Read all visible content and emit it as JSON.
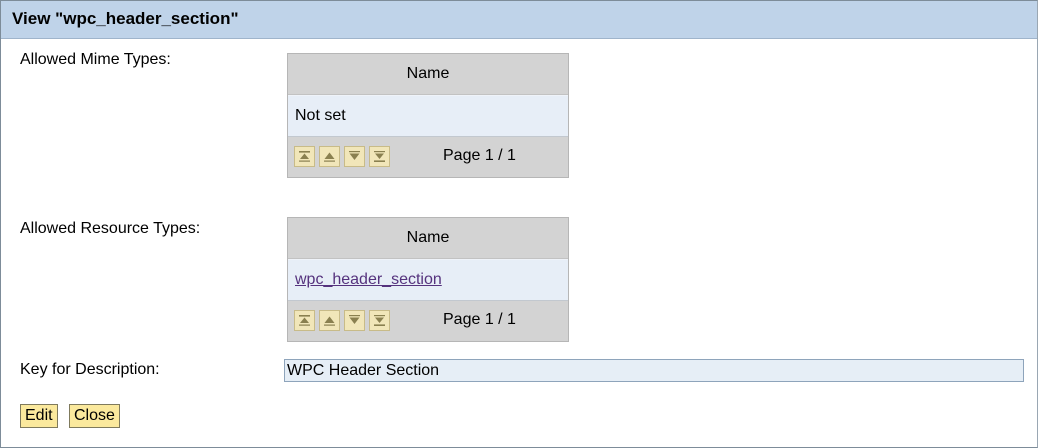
{
  "view": {
    "title": "View \"wpc_header_section\""
  },
  "mime_types": {
    "label": "Allowed Mime Types:",
    "column": "Name",
    "rows": [
      "Not set"
    ],
    "pager": "Page 1 / 1"
  },
  "resource_types": {
    "label": "Allowed Resource Types:",
    "column": "Name",
    "rows": [
      "wpc_header_section"
    ],
    "pager": "Page 1 / 1"
  },
  "description": {
    "label": "Key for Description:",
    "value": "WPC Header Section"
  },
  "actions": {
    "edit_label": "Edit",
    "close_label": "Close"
  },
  "colors": {
    "title_bar": "#bfd3e9",
    "table_bg": "#d3d3d3",
    "row_bg": "#e7eef7",
    "button_bg": "#fbe99d",
    "pager_button_bg": "#f1e6b9",
    "link": "#55327d"
  },
  "icons": [
    "first-page-icon",
    "previous-page-icon",
    "next-page-icon",
    "last-page-icon"
  ]
}
